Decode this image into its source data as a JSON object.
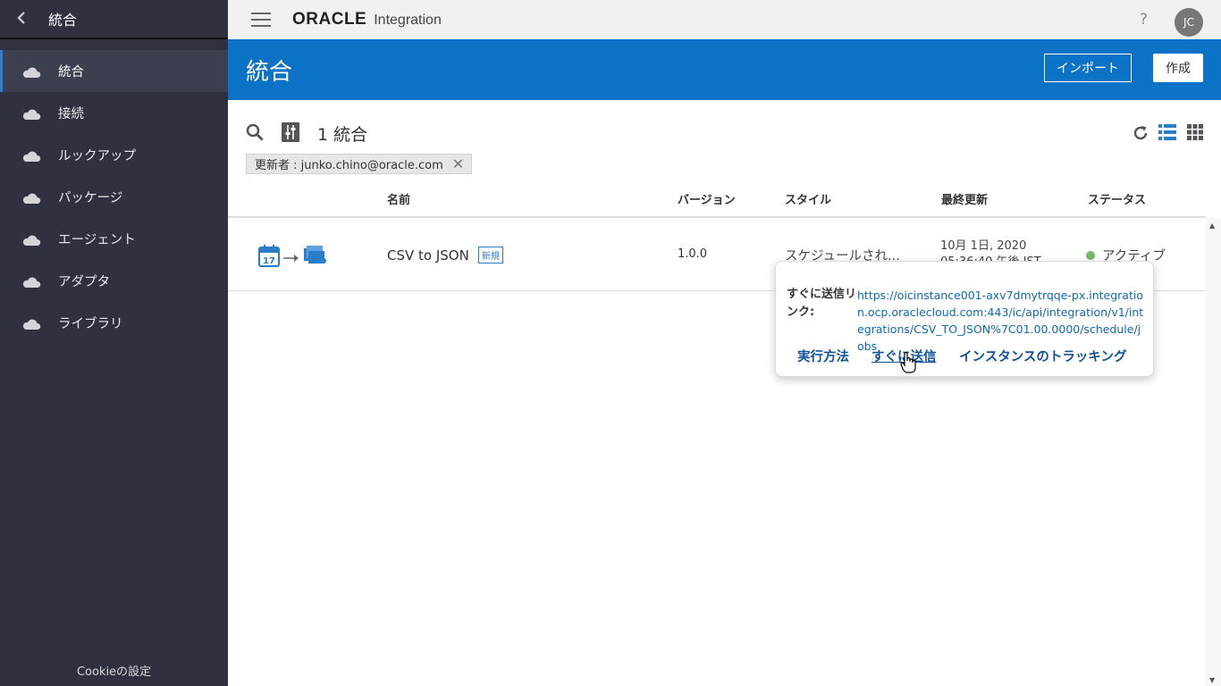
{
  "sidebar": {
    "title": "統合",
    "items": [
      {
        "label": "統合",
        "active": true
      },
      {
        "label": "接続"
      },
      {
        "label": "ルックアップ"
      },
      {
        "label": "パッケージ"
      },
      {
        "label": "エージェント"
      },
      {
        "label": "アダプタ"
      },
      {
        "label": "ライブラリ"
      }
    ],
    "footer": "Cookieの設定"
  },
  "topbar": {
    "logo_brand": "ORACLE",
    "logo_product": "Integration",
    "help": "?",
    "avatar": "JC"
  },
  "banner": {
    "title": "統合",
    "import_label": "インポート",
    "create_label": "作成"
  },
  "toolbar": {
    "count": "1 統合",
    "filter_chip": "更新者 : junko.chino@oracle.com"
  },
  "table": {
    "headers": {
      "name": "名前",
      "version": "バージョン",
      "style": "スタイル",
      "updated": "最終更新",
      "status": "ステータス"
    },
    "rows": [
      {
        "name": "CSV to JSON",
        "badge": "新規",
        "version": "1.0.0",
        "style": "スケジュールされ...",
        "updated_date": "10月 1日, 2020",
        "updated_time": "05:36:40 午後 JST",
        "status": "アクティブ",
        "status_color": "#73b86a"
      }
    ]
  },
  "popup": {
    "label": "すぐに送信リンク:",
    "url": "https://oicinstance001-axv7dmytrqqe-px.integration.ocp.oraclecloud.com:443/ic/api/integration/v1/integrations/CSV_TO_JSON%7C01.00.0000/schedule/jobs",
    "actions": {
      "run": "実行方法",
      "submit": "すぐに送信",
      "track": "インスタンスのトラッキング"
    }
  },
  "colors": {
    "sidebar_bg": "#2f3140",
    "banner_bg": "#0c72c5",
    "accent": "#2f7fd0",
    "link": "#0c6bb8",
    "active_status": "#73b86a"
  }
}
